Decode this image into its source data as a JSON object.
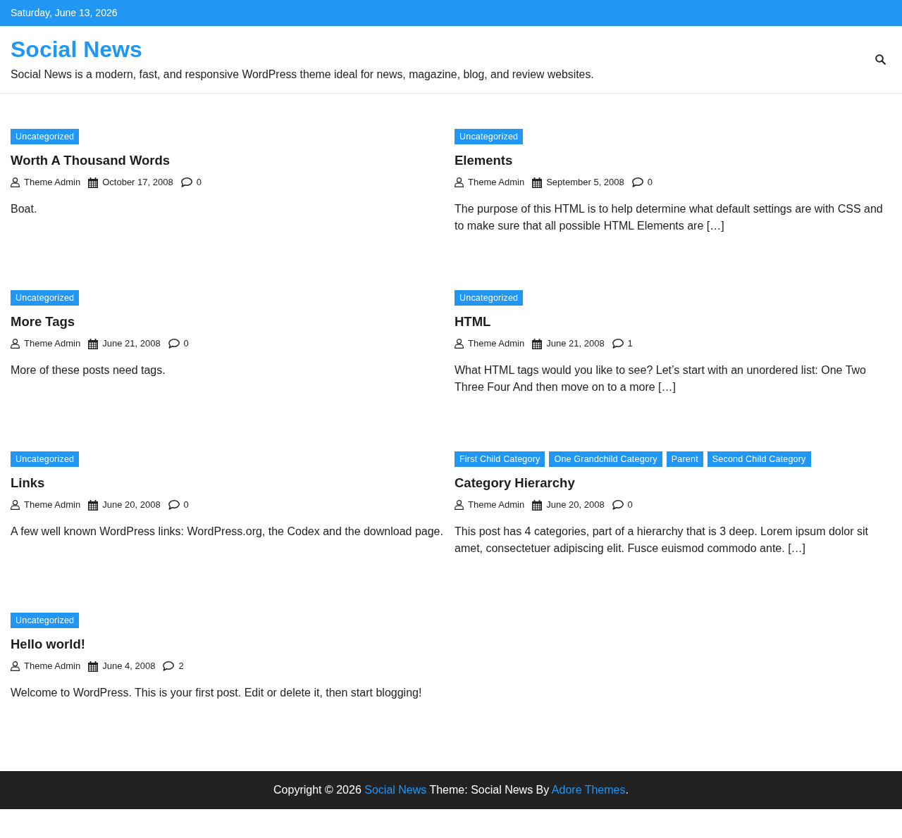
{
  "top_bar": {
    "date": "Saturday, June 13, 2026"
  },
  "header": {
    "site_title": "Social News",
    "tagline": "Social News is a modern, fast, and responsive WordPress theme ideal for news, magazine, blog, and review websites."
  },
  "posts": [
    {
      "categories": [
        "Uncategorized"
      ],
      "title": "Worth A Thousand Words",
      "author": "Theme Admin",
      "date": "October 17, 2008",
      "comments": "0",
      "excerpt": "Boat."
    },
    {
      "categories": [
        "Uncategorized"
      ],
      "title": "Elements",
      "author": "Theme Admin",
      "date": "September 5, 2008",
      "comments": "0",
      "excerpt": "The purpose of this HTML is to help determine what default settings are with CSS and to make sure that all possible HTML Elements are […]"
    },
    {
      "categories": [
        "Uncategorized"
      ],
      "title": "More Tags",
      "author": "Theme Admin",
      "date": "June 21, 2008",
      "comments": "0",
      "excerpt": "More of these posts need tags."
    },
    {
      "categories": [
        "Uncategorized"
      ],
      "title": "HTML",
      "author": "Theme Admin",
      "date": "June 21, 2008",
      "comments": "1",
      "excerpt": "What HTML tags would you like to see? Let’s start with an unordered list: One Two Three Four And then move on to a more […]"
    },
    {
      "categories": [
        "Uncategorized"
      ],
      "title": "Links",
      "author": "Theme Admin",
      "date": "June 20, 2008",
      "comments": "0",
      "excerpt": "A few well known WordPress links: WordPress.org, the Codex and the download page."
    },
    {
      "categories": [
        "First Child Category",
        "One Grandchild Category",
        "Parent",
        "Second Child Category"
      ],
      "title": "Category Hierarchy",
      "author": "Theme Admin",
      "date": "June 20, 2008",
      "comments": "0",
      "excerpt": "This post has 4 categories, part of a hierarchy that is 3 deep. Lorem ipsum dolor sit amet, consectetuer adipiscing elit. Fusce euismod commodo ante. […]"
    },
    {
      "categories": [
        "Uncategorized"
      ],
      "title": "Hello world!",
      "author": "Theme Admin",
      "date": "June 4, 2008",
      "comments": "2",
      "excerpt": "Welcome to WordPress. This is your first post. Edit or delete it, then start blogging!"
    }
  ],
  "footer": {
    "segments": [
      {
        "kind": "text",
        "text": "Copyright © 2026 "
      },
      {
        "kind": "link",
        "text": "Social News"
      },
      {
        "kind": "text",
        "text": " Theme: Social News By "
      },
      {
        "kind": "link",
        "text": "Adore Themes"
      },
      {
        "kind": "text",
        "text": "."
      }
    ]
  }
}
